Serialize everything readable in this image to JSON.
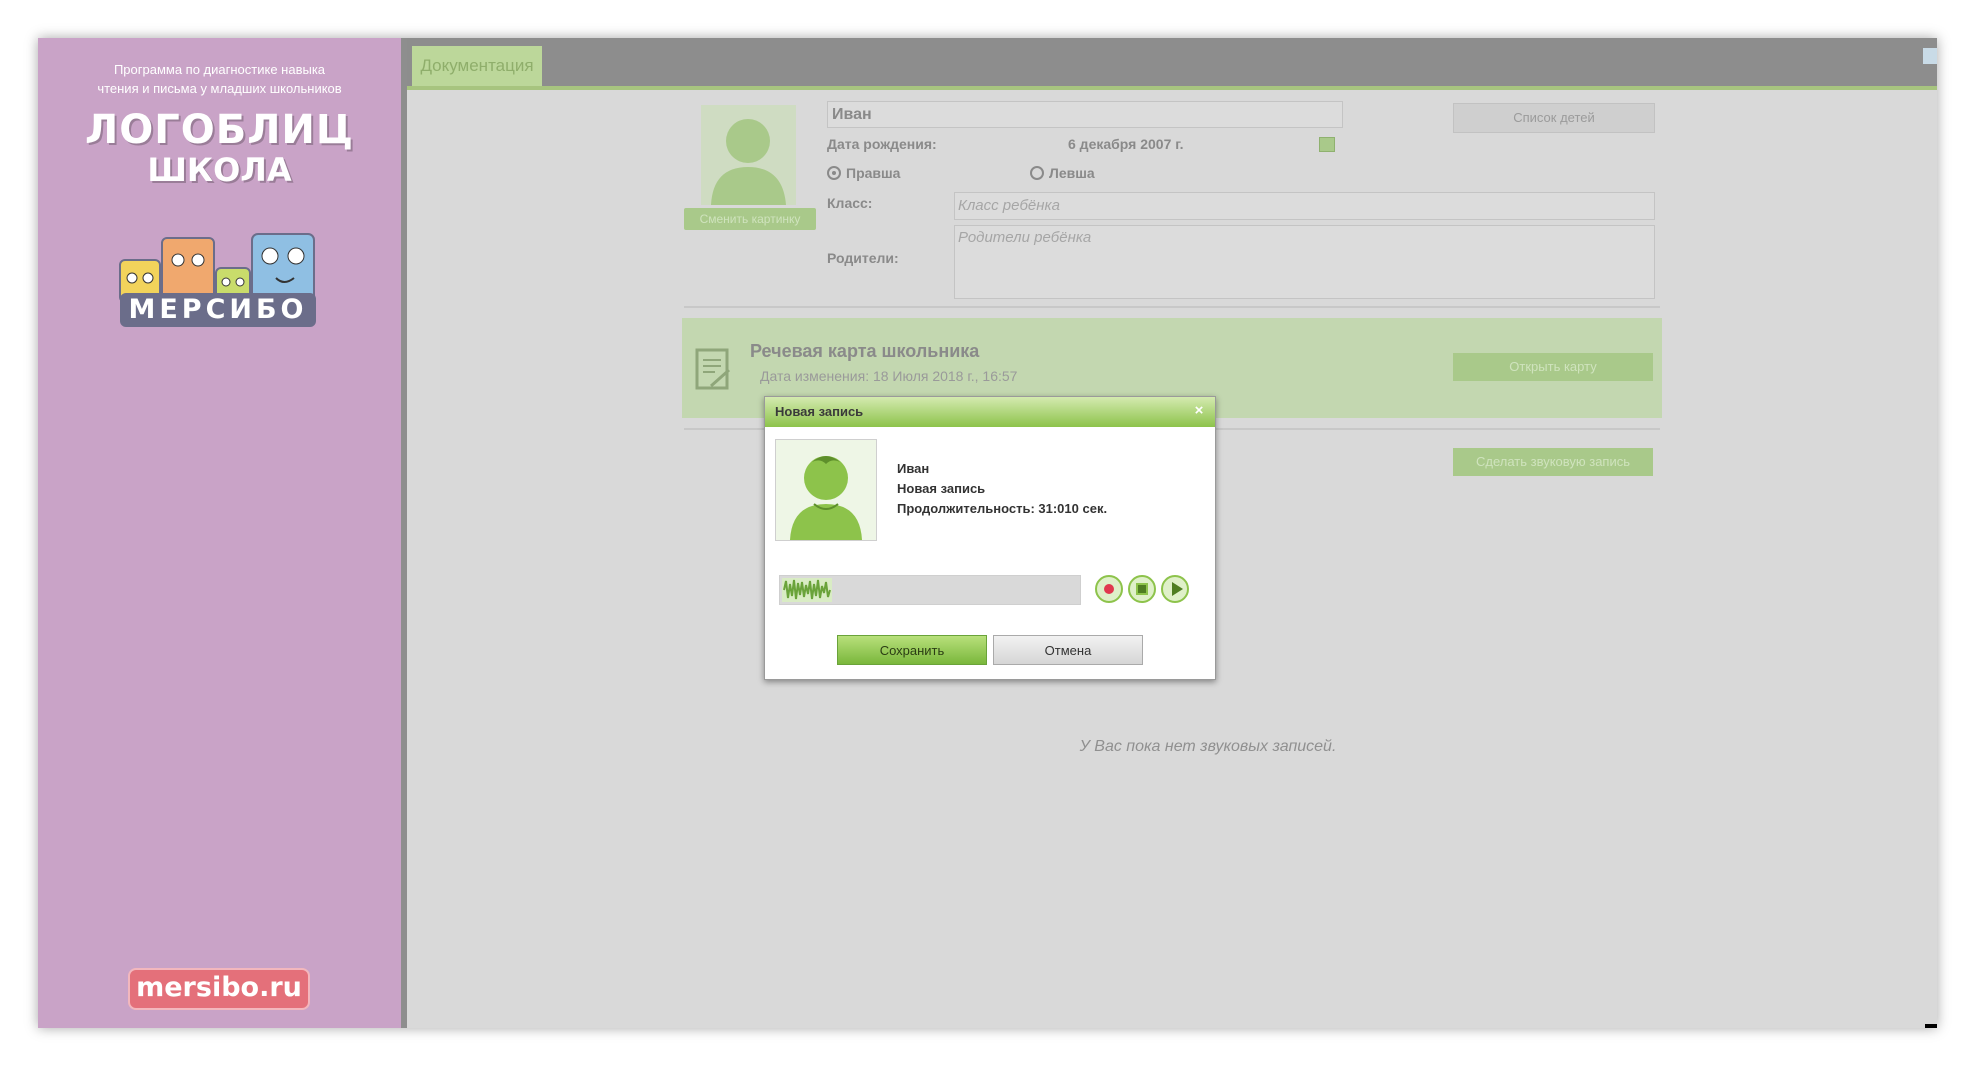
{
  "sidebar": {
    "tagline_line1": "Программа по диагностике навыка",
    "tagline_line2": "чтения и письма у младших школьников",
    "logo_title": "ЛОГОБЛИЦ",
    "logo_subtitle": "ШКОЛА",
    "brand": "МЕРСИБО",
    "site": "mersibo.ru"
  },
  "tabs": [
    {
      "label": "Документация"
    }
  ],
  "profile": {
    "name": "Иван",
    "change_picture_label": "Сменить картинку",
    "children_list_label": "Список детей",
    "dob_label": "Дата рождения:",
    "dob_value": "6 декабря 2007 г.",
    "hand_options": [
      "Правша",
      "Левша"
    ],
    "hand_selected": "Правша",
    "class_label": "Класс:",
    "class_placeholder": "Класс ребёнка",
    "parents_label": "Родители:",
    "parents_placeholder": "Родители ребёнка"
  },
  "speech_card": {
    "title": "Речевая карта школьника",
    "modified": "Дата изменения: 18 Июля 2018 г., 16:57",
    "open_label": "Открыть карту"
  },
  "sound_records": {
    "make_record_label": "Сделать звуковую запись",
    "empty_message": "У Вас пока нет звуковых записей."
  },
  "dialog": {
    "title": "Новая запись",
    "close": "×",
    "name": "Иван",
    "record_name": "Новая запись",
    "duration": "Продолжительность: 31:010 сек.",
    "save_label": "Сохранить",
    "cancel_label": "Отмена"
  },
  "colors": {
    "sidebar": "#c9a3c7",
    "accent_green": "#8dc34b",
    "record_red": "#e0394e",
    "brand_badge": "#e4707a"
  }
}
